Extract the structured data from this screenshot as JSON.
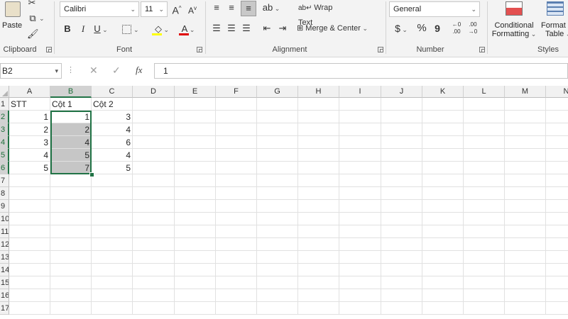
{
  "ribbon": {
    "clipboard": {
      "label": "Clipboard",
      "paste_label": "Paste"
    },
    "font": {
      "label": "Font",
      "font_name": "Calibri",
      "font_size": "11",
      "bold": "B",
      "italic": "I",
      "underline": "U",
      "grow": "A",
      "shrink": "A",
      "font_color_letter": "A",
      "highlight_color": "#ffff00",
      "font_color": "#e00000"
    },
    "alignment": {
      "label": "Alignment",
      "wrap_text": "Wrap Text",
      "merge_center": "Merge & Center"
    },
    "number": {
      "label": "Number",
      "format": "General",
      "currency": "$",
      "percent": "%",
      "comma": "9",
      "inc_decimal": "←0 .00",
      "dec_decimal": ".00 →0"
    },
    "styles": {
      "label": "Styles",
      "conditional_1": "Conditional",
      "conditional_2": "Formatting",
      "format_table_1": "Format as",
      "format_table_2": "Table"
    }
  },
  "formula_bar": {
    "name_box": "B2",
    "fx": "fx",
    "value": "1"
  },
  "sheet": {
    "columns": [
      "A",
      "B",
      "C",
      "D",
      "E",
      "F",
      "G",
      "H",
      "I",
      "J",
      "K",
      "L",
      "M",
      "N"
    ],
    "row_numbers": [
      "1",
      "2",
      "3",
      "4",
      "5",
      "6",
      "7",
      "8",
      "9",
      "10",
      "11",
      "12",
      "13",
      "14",
      "15",
      "16",
      "17"
    ],
    "header_row": [
      "STT",
      "Cột 1",
      "Cột 2"
    ],
    "data_rows": [
      [
        "1",
        "1",
        "3"
      ],
      [
        "2",
        "2",
        "4"
      ],
      [
        "3",
        "4",
        "6"
      ],
      [
        "4",
        "5",
        "4"
      ],
      [
        "5",
        "7",
        "5"
      ]
    ],
    "selection": "B2:B6",
    "accent_color": "#217346"
  }
}
